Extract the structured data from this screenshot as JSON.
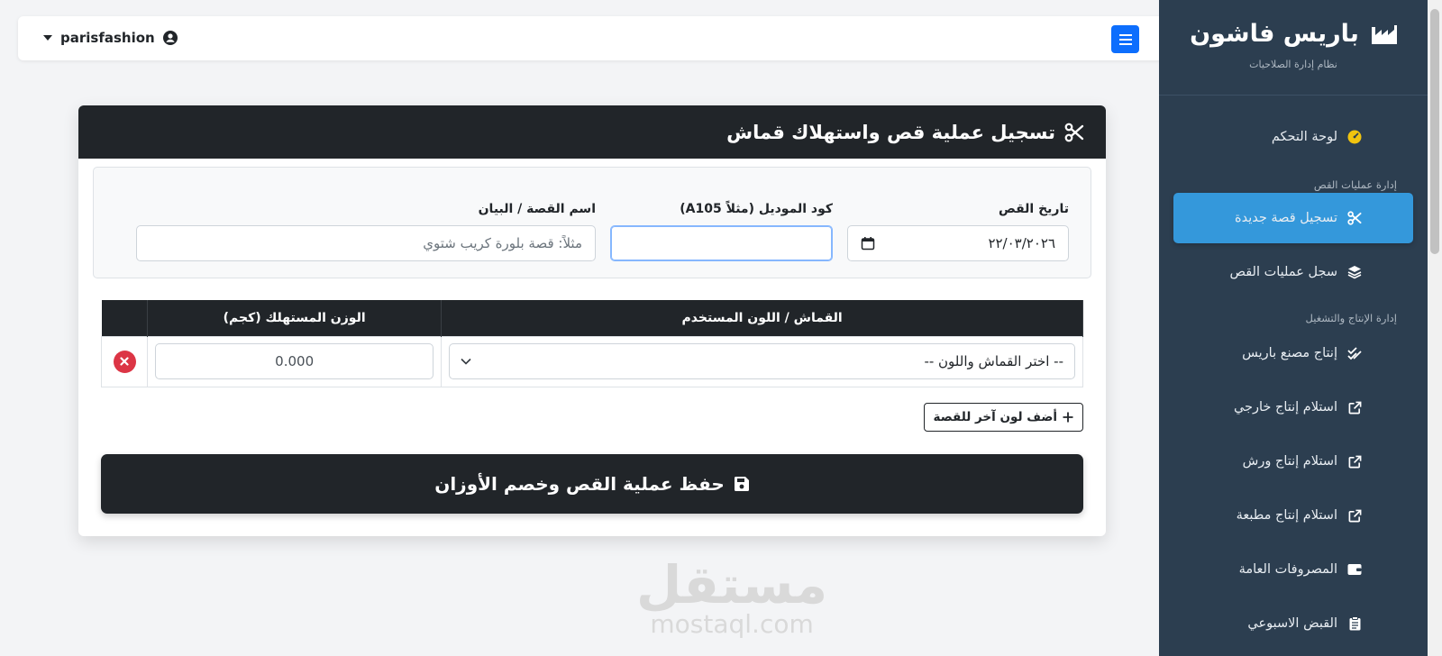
{
  "sidebar": {
    "brand": "باريس فاشون",
    "subtitle": "نظام إدارة الصلاحيات",
    "items": [
      {
        "label": "لوحة التحكم",
        "icon": "gauge-icon"
      },
      {
        "label": "تسجيل قصة جديدة",
        "icon": "scissors-icon",
        "active": true
      },
      {
        "label": "سجل عمليات القص",
        "icon": "layers-icon"
      },
      {
        "label": "إنتاج مصنع باريس",
        "icon": "check-double-icon"
      },
      {
        "label": "استلام إنتاج خارجي",
        "icon": "external-link-icon"
      },
      {
        "label": "استلام إنتاج ورش",
        "icon": "external-link-icon"
      },
      {
        "label": "استلام إنتاج مطبعة",
        "icon": "external-link-icon"
      },
      {
        "label": "المصروفات العامة",
        "icon": "wallet-icon"
      },
      {
        "label": "القبض الاسبوعي",
        "icon": "clipboard-icon"
      }
    ],
    "sections": [
      "إدارة عمليات القص",
      "إدارة الإنتاج والتشغيل"
    ]
  },
  "topbar": {
    "username": "parisfashion"
  },
  "card": {
    "title": "تسجيل عملية قص واستهلاك قماش",
    "fields": {
      "date_label": "تاريخ القص",
      "date_value": "٢٢/٠٣/٢٠٢٦",
      "model_label": "كود الموديل (مثلاً A105)",
      "model_value": "",
      "name_label": "اسم القصة / البيان",
      "name_placeholder": "مثلاً: قصة بلورة كريب شتوي"
    },
    "table": {
      "headers": [
        "القماش / اللون المستخدم",
        "الوزن المستهلك (كجم)",
        ""
      ],
      "rows": [
        {
          "fabric": "-- اختر القماش واللون --",
          "weight": "0.000"
        }
      ]
    },
    "add_color_label": "أضف لون آخر للقصة",
    "save_label": "حفظ عملية القص وخصم الأوزان"
  },
  "watermark": {
    "arabic": "مستقل",
    "latin": "mostaql.com"
  },
  "colors": {
    "sidebar": "#2c3e50",
    "active": "#3498db",
    "dark": "#212529",
    "primary": "#0d6efd",
    "danger": "#dc3545"
  }
}
